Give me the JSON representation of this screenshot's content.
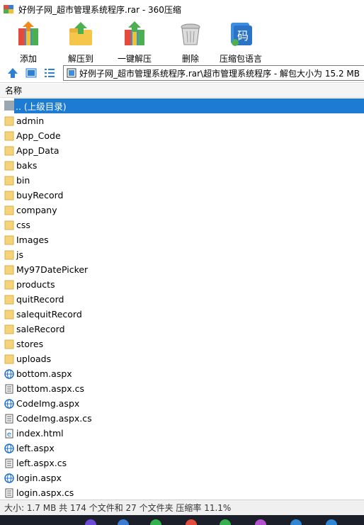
{
  "window": {
    "title": "好例子网_超市管理系统程序.rar - 360压缩"
  },
  "toolbar": {
    "buttons": [
      {
        "label": "添加",
        "icon": "add-archive-icon"
      },
      {
        "label": "解压到",
        "icon": "extract-to-icon"
      },
      {
        "label": "一键解压",
        "icon": "one-click-extract-icon"
      },
      {
        "label": "删除",
        "icon": "delete-icon"
      },
      {
        "label": "压缩包语言",
        "icon": "archive-language-icon"
      }
    ]
  },
  "addressbar": {
    "path": "好例子网_超市管理系统程序.rar\\超市管理系统程序 - 解包大小为 15.2 MB"
  },
  "columns": {
    "name": "名称"
  },
  "files": [
    {
      "name": ".. (上级目录)",
      "type": "parent",
      "selected": true
    },
    {
      "name": "admin",
      "type": "folder"
    },
    {
      "name": "App_Code",
      "type": "folder"
    },
    {
      "name": "App_Data",
      "type": "folder"
    },
    {
      "name": "baks",
      "type": "folder"
    },
    {
      "name": "bin",
      "type": "folder"
    },
    {
      "name": "buyRecord",
      "type": "folder"
    },
    {
      "name": "company",
      "type": "folder"
    },
    {
      "name": "css",
      "type": "folder"
    },
    {
      "name": "Images",
      "type": "folder"
    },
    {
      "name": "js",
      "type": "folder"
    },
    {
      "name": "My97DatePicker",
      "type": "folder"
    },
    {
      "name": "products",
      "type": "folder"
    },
    {
      "name": "quitRecord",
      "type": "folder"
    },
    {
      "name": "salequitRecord",
      "type": "folder"
    },
    {
      "name": "saleRecord",
      "type": "folder"
    },
    {
      "name": "stores",
      "type": "folder"
    },
    {
      "name": "uploads",
      "type": "folder"
    },
    {
      "name": "bottom.aspx",
      "type": "web"
    },
    {
      "name": "bottom.aspx.cs",
      "type": "doc"
    },
    {
      "name": "CodeImg.aspx",
      "type": "web"
    },
    {
      "name": "CodeImg.aspx.cs",
      "type": "doc"
    },
    {
      "name": "index.html",
      "type": "html"
    },
    {
      "name": "left.aspx",
      "type": "web"
    },
    {
      "name": "left.aspx.cs",
      "type": "doc"
    },
    {
      "name": "login.aspx",
      "type": "web"
    },
    {
      "name": "login.aspx.cs",
      "type": "doc"
    }
  ],
  "status": {
    "text": "大小: 1.7 MB 共 174 个文件和 27 个文件夹 压缩率 11.1%"
  },
  "colors": {
    "selection": "#1e7bd4",
    "folder": "#f5d37a",
    "web": "#1e6fc9"
  }
}
